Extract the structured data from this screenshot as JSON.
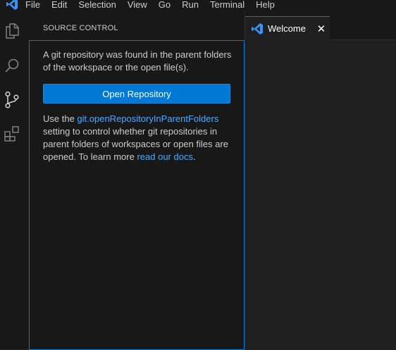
{
  "menubar": {
    "items": [
      "File",
      "Edit",
      "Selection",
      "View",
      "Go",
      "Run",
      "Terminal",
      "Help"
    ]
  },
  "activitybar": {
    "icons": [
      "explorer-icon",
      "search-icon",
      "source-control-icon",
      "extensions-icon"
    ]
  },
  "sidebar": {
    "title": "SOURCE CONTROL",
    "message": "A git repository was found in the parent folders of the workspace or the open file(s).",
    "open_button_label": "Open Repository",
    "info_prefix": "Use the ",
    "info_setting_link": "git.openRepositoryInParentFolders",
    "info_middle": " setting to control whether git repositories in parent folders of workspaces or open files are opened. To learn more ",
    "info_docs_link": "read our docs",
    "info_suffix": "."
  },
  "editor": {
    "tabs": [
      {
        "label": "Welcome",
        "close": "✕"
      }
    ]
  },
  "colors": {
    "accent": "#0078d4",
    "link": "#4daafc",
    "vscode_logo": "#3794ff"
  }
}
